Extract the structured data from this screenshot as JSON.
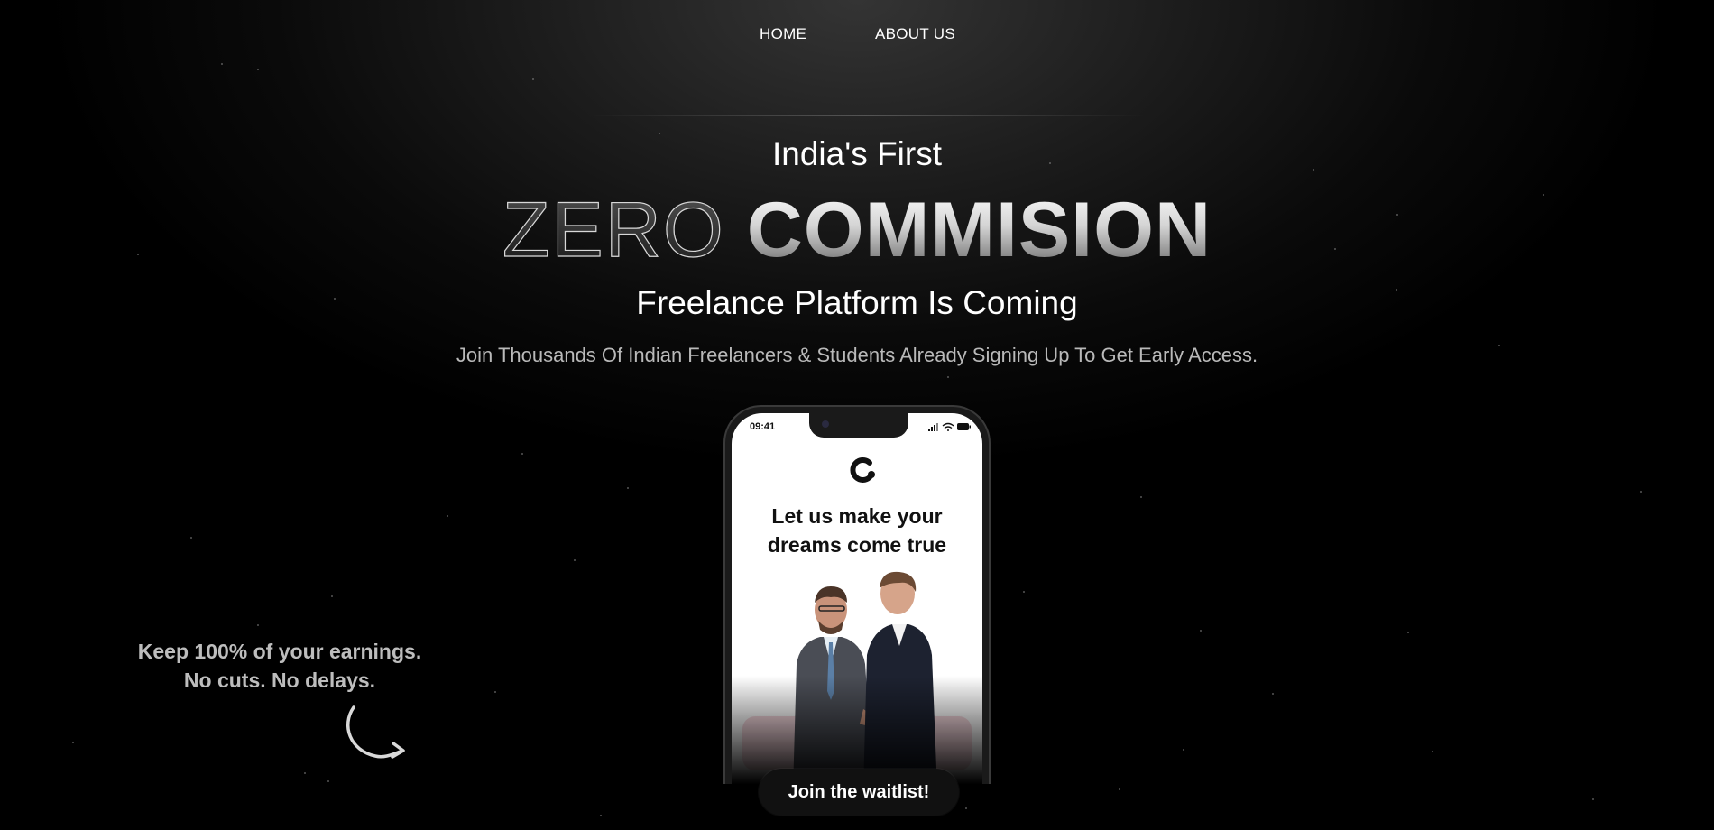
{
  "nav": {
    "items": [
      {
        "label": "HOME"
      },
      {
        "label": "ABOUT US"
      }
    ]
  },
  "hero": {
    "pre_title": "India's First",
    "headline_light": "ZERO",
    "headline_bold": "COMMISION",
    "sub_title": "Freelance Platform Is Coming",
    "tagline": "Join Thousands Of Indian Freelancers & Students Already Signing Up To Get Early Access."
  },
  "phone": {
    "status_time": "09:41",
    "title_line1": "Let us make your",
    "title_line2": "dreams come true"
  },
  "callout": {
    "line1": "Keep 100% of your earnings.",
    "line2": "No cuts. No delays."
  },
  "cta": {
    "label": "Join the waitlist!"
  },
  "colors": {
    "background": "#000000",
    "accent_pink": "#f6d8de",
    "text_primary": "#ffffff",
    "text_muted": "#b9b9b9"
  },
  "icons": [
    "logo-icon",
    "signal-icon",
    "wifi-icon",
    "battery-icon",
    "curved-arrow-icon"
  ]
}
